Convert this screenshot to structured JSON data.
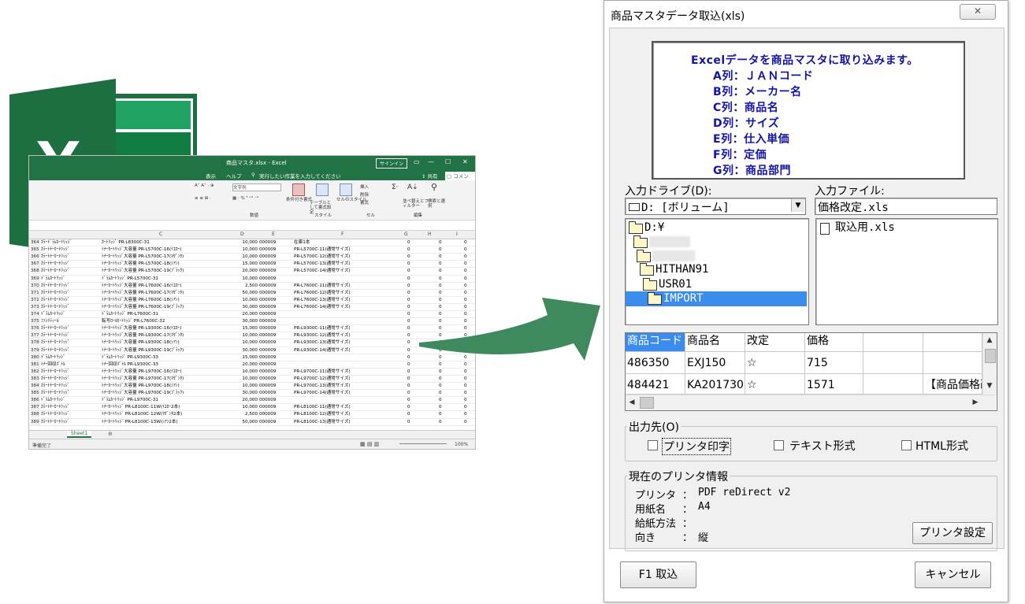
{
  "excel": {
    "title": "商品マスタ.xlsx - Excel",
    "signin_label": "サインイン",
    "tabs": [
      "表示",
      "ヘルプ",
      "実行したい作業を入力してください"
    ],
    "share_label": "共有",
    "comment_label": "コメント",
    "ribbon_groups": [
      "数値",
      "スタイル",
      "セル",
      "編集"
    ],
    "ribbon_buttons": [
      "条件付き書式",
      "テーブルとして書式設定",
      "セルのスタイル",
      "挿入",
      "削除",
      "書式",
      "並べ替えとフィルター",
      "検索と選択"
    ],
    "number_format": "文字列",
    "columns": [
      "C",
      "D",
      "E",
      "F",
      "G",
      "H",
      "I"
    ],
    "rows": [
      {
        "n": "364",
        "a": "ｶﾗｰﾄﾞﾗﾑｶｰﾄﾘｯｼﾞ",
        "c": "ｶｰﾄﾘｯｼﾞ PR-L8300C-31",
        "d": "10,000",
        "e": "000009",
        "f": "在庫1本",
        "g": "0",
        "h": "0",
        "i": "0"
      },
      {
        "n": "365",
        "a": "ｶﾗｰﾄﾅｰｶｰﾄﾘｯｼﾞ",
        "c": "ﾄﾅｰｶｰﾄﾘｯｼﾞ大容量 PR-L5700C-16(ｲｴﾛｰ)",
        "d": "10,000",
        "e": "000009",
        "f": "PR-L5700C-11(通常サイズ)",
        "g": "0",
        "h": "0",
        "i": "0"
      },
      {
        "n": "366",
        "a": "ｶﾗｰﾄﾅｰｶｰﾄﾘｯｼﾞ",
        "c": "ﾄﾅｰｶｰﾄﾘｯｼﾞ大容量 PR-L5700C-17(ﾏｾﾞﾝﾀ)",
        "d": "10,000",
        "e": "000009",
        "f": "PR-L5700C-12(通常サイズ)",
        "g": "0",
        "h": "0",
        "i": "0"
      },
      {
        "n": "367",
        "a": "ｶﾗｰﾄﾅｰｶｰﾄﾘｯｼﾞ",
        "c": "ﾄﾅｰｶｰﾄﾘｯｼﾞ大容量 PR-L5700C-18(ｼｱﾝ)",
        "d": "15,000",
        "e": "000009",
        "f": "PR-L5700C-13(通常サイズ)",
        "g": "0",
        "h": "0",
        "i": "0"
      },
      {
        "n": "368",
        "a": "ｶﾗｰﾄﾅｰｶｰﾄﾘｯｼﾞ",
        "c": "ﾄﾅｰｶｰﾄﾘｯｼﾞ大容量 PR-L5700C-19(ﾌﾞﾗｯｸ)",
        "d": "20,000",
        "e": "000009",
        "f": "PR-L5700C-14(通常サイズ)",
        "g": "0",
        "h": "0",
        "i": "0"
      },
      {
        "n": "369",
        "a": "ﾄﾞﾗﾑｶｰﾄﾘｯｼﾞ",
        "c": "ﾄﾞﾗﾑｶｰﾄﾘｯｼﾞ PR-L5700C-31",
        "d": "10,000",
        "e": "000009",
        "f": "",
        "g": "0",
        "h": "0",
        "i": "0"
      },
      {
        "n": "370",
        "a": "ｶﾗｰﾄﾅｰｶｰﾄﾘｯｼﾞ",
        "c": "ﾄﾅｰｶｰﾄﾘｯｼﾞ大容量 PR-L7600C-16(ｲｴﾛｰ)",
        "d": "2,500",
        "e": "000009",
        "f": "PR-L7600C-11(通常サイズ)",
        "g": "0",
        "h": "0",
        "i": "0"
      },
      {
        "n": "371",
        "a": "ｶﾗｰﾄﾅｰｶｰﾄﾘｯｼﾞ",
        "c": "ﾄﾅｰｶｰﾄﾘｯｼﾞ大容量 PR-L7600C-17(ﾏｾﾞﾝﾀ)",
        "d": "50,000",
        "e": "000009",
        "f": "PR-L7600C-12(通常サイズ)",
        "g": "0",
        "h": "0",
        "i": "0"
      },
      {
        "n": "372",
        "a": "ｶﾗｰﾄﾅｰｶｰﾄﾘｯｼﾞ",
        "c": "ﾄﾅｰｶｰﾄﾘｯｼﾞ大容量 PR-L7600C-18(ｼｱﾝ)",
        "d": "10,000",
        "e": "000009",
        "f": "PR-L7600C-13(通常サイズ)",
        "g": "0",
        "h": "0",
        "i": "0"
      },
      {
        "n": "373",
        "a": "ｶﾗｰﾄﾅｰｶｰﾄﾘｯｼﾞ",
        "c": "ﾄﾅｰｶｰﾄﾘｯｼﾞ大容量 PR-L7600C-19(ﾌﾞﾗｯｸ)",
        "d": "30,000",
        "e": "000009",
        "f": "PR-L7600C-14(通常サイズ)",
        "g": "0",
        "h": "0",
        "i": "0"
      },
      {
        "n": "374",
        "a": "ﾄﾞﾗﾑｶｰﾄﾘｯｼﾞ",
        "c": "ﾄﾞﾗﾑｶｰﾄﾘｯｼﾞ PR-L7600C-31",
        "d": "20,000",
        "e": "000009",
        "f": "",
        "g": "0",
        "h": "0",
        "i": "0"
      },
      {
        "n": "375",
        "a": "ﾌｧｼﾘﾃｨｰﾙ",
        "c": "転写ﾛｰﾙｶｰﾄﾘｯｼﾞ PR-L7600C-32",
        "d": "30,000",
        "e": "000009",
        "f": "",
        "g": "0",
        "h": "0",
        "i": "0"
      },
      {
        "n": "376",
        "a": "ｶﾗｰﾄﾅｰｶｰﾄﾘｯｼﾞ",
        "c": "ﾄﾅｰｶｰﾄﾘｯｼﾞ大容量 PR-L9300C-16(ｲｴﾛｰ)",
        "d": "15,000",
        "e": "000009",
        "f": "PR-L9300C-11(通常サイズ)",
        "g": "0",
        "h": "0",
        "i": "0"
      },
      {
        "n": "377",
        "a": "ｶﾗｰﾄﾅｰｶｰﾄﾘｯｼﾞ",
        "c": "ﾄﾅｰｶｰﾄﾘｯｼﾞ大容量 PR-L9300C-17(ﾏｾﾞﾝﾀ)",
        "d": "10,000",
        "e": "000009",
        "f": "PR-L9300C-12(通常サイズ)",
        "g": "0",
        "h": "0",
        "i": "0"
      },
      {
        "n": "378",
        "a": "ｶﾗｰﾄﾅｰｶｰﾄﾘｯｼﾞ",
        "c": "ﾄﾅｰｶｰﾄﾘｯｼﾞ大容量 PR-L9300C-18(ｼｱﾝ)",
        "d": "10,000",
        "e": "000009",
        "f": "PR-L9300C-13(通常サイズ)",
        "g": "0",
        "h": "0",
        "i": "0"
      },
      {
        "n": "379",
        "a": "ｶﾗｰﾄﾅｰｶｰﾄﾘｯｼﾞ",
        "c": "ﾄﾅｰｶｰﾄﾘｯｼﾞ大容量 PR-L9300C-19(ﾌﾞﾗｯｸ)",
        "d": "30,000",
        "e": "000009",
        "f": "PR-L9300C-14(通常サイズ)",
        "g": "0",
        "h": "0",
        "i": "0"
      },
      {
        "n": "380",
        "a": "ﾄﾞﾗﾑｶｰﾄﾘｯｼﾞ",
        "c": "ﾄﾞﾗﾑｶｰﾄﾘｯｼﾞ PR-L9300C-33",
        "d": "15,000",
        "e": "000009",
        "f": "",
        "g": "0",
        "h": "0",
        "i": "0"
      },
      {
        "n": "381",
        "a": "ﾄﾅｰ回収ﾎﾞﾄﾙ",
        "c": "ﾄﾅｰ回収ﾎﾞﾄﾙ PR-L9300C-33",
        "d": "20,000",
        "e": "000009",
        "f": "",
        "g": "0",
        "h": "0",
        "i": "0"
      },
      {
        "n": "382",
        "a": "ｶﾗｰﾄﾅｰｶｰﾄﾘｯｼﾞ",
        "c": "ﾄﾅｰｶｰﾄﾘｯｼﾞ大容量 PR-L9700C-16(ｲｴﾛｰ)",
        "d": "10,000",
        "e": "000009",
        "f": "PR-L9700C-11(通常サイズ)",
        "g": "0",
        "h": "0",
        "i": "0"
      },
      {
        "n": "383",
        "a": "ｶﾗｰﾄﾅｰｶｰﾄﾘｯｼﾞ",
        "c": "ﾄﾅｰｶｰﾄﾘｯｼﾞ大容量 PR-L9700C-17(ﾏｾﾞﾝﾀ)",
        "d": "10,000",
        "e": "000009",
        "f": "PR-L9700C-12(通常サイズ)",
        "g": "0",
        "h": "0",
        "i": "0"
      },
      {
        "n": "384",
        "a": "ｶﾗｰﾄﾅｰｶｰﾄﾘｯｼﾞ",
        "c": "ﾄﾅｰｶｰﾄﾘｯｼﾞ大容量 PR-L9700C-18(ｼｱﾝ)",
        "d": "10,000",
        "e": "000009",
        "f": "PR-L9700C-13(通常サイズ)",
        "g": "0",
        "h": "0",
        "i": "0"
      },
      {
        "n": "385",
        "a": "ｶﾗｰﾄﾅｰｶｰﾄﾘｯｼﾞ",
        "c": "ﾄﾅｰｶｰﾄﾘｯｼﾞ大容量 PR-L9700C-19(ﾌﾞﾗｯｸ)",
        "d": "30,000",
        "e": "000009",
        "f": "PR-L9700C-14(通常サイズ)",
        "g": "0",
        "h": "0",
        "i": "0"
      },
      {
        "n": "386",
        "a": "ﾄﾞﾗﾑｶｰﾄﾘｯｼﾞ",
        "c": "ﾄﾞﾗﾑｶｰﾄﾘｯｼﾞ PR-L9700C-31",
        "d": "20,000",
        "e": "000009",
        "f": "",
        "g": "0",
        "h": "0",
        "i": "0"
      },
      {
        "n": "387",
        "a": "ｶﾗｰﾄﾅｰｶｰﾄﾘｯｼﾞ",
        "c": "ﾄﾅｰｶｰﾄﾘｯｼﾞ PR-L8100C-11W(ｲｴﾛｰ2本)",
        "d": "10,000",
        "e": "000009",
        "f": "PR-L8100C-11(通常サイズ)",
        "g": "0",
        "h": "0",
        "i": "0"
      },
      {
        "n": "388",
        "a": "ｶﾗｰﾄﾅｰｶｰﾄﾘｯｼﾞ",
        "c": "ﾄﾅｰｶｰﾄﾘｯｼﾞ PR-L8100C-12W(ﾏｾﾞﾝﾀ2本)",
        "d": "2,500",
        "e": "000009",
        "f": "PR-L8100C-12(通常サイズ)",
        "g": "0",
        "h": "0",
        "i": "0"
      },
      {
        "n": "389",
        "a": "ｶﾗｰﾄﾅｰｶｰﾄﾘｯｼﾞ",
        "c": "ﾄﾅｰｶｰﾄﾘｯｼﾞ PR-L8100C-13W(ｼｱﾝ2本)",
        "d": "50,000",
        "e": "000009",
        "f": "PR-L8100C-13(通常サイズ)",
        "g": "0",
        "h": "0",
        "i": "0"
      }
    ],
    "sheet_tab": "Sheet1",
    "status_text": "準備完了",
    "zoom": "100%"
  },
  "dialog": {
    "title": "商品マスタデータ取込(xls)",
    "info_lines": [
      "Excelデータを商品マスタに取り込みます。",
      "A列：ＪＡＮコード",
      "B列：メーカー名",
      "C列：商品名",
      "D列：サイズ",
      "E列：仕入単価",
      "F列：定価",
      "G列：商品部門"
    ],
    "drive_label": "入力ドライブ(D):",
    "file_label": "入力ファイル:",
    "drive_value": "D: [ボリューム]",
    "file_value": "価格改定.xls",
    "dirs": [
      "D:¥",
      "HITHAN91",
      "USR01",
      "IMPORT"
    ],
    "files": [
      "取込用.xls"
    ],
    "grid": {
      "headers": [
        "商品コード",
        "商品名",
        "改定",
        "価格"
      ],
      "rows": [
        {
          "code": "486350",
          "name": "EXJ150",
          "kaitei": "☆",
          "price": "715",
          "note": ""
        },
        {
          "code": "484421",
          "name": "KA201730",
          "kaitei": "☆",
          "price": "1571",
          "note": "【商品価格改"
        }
      ]
    },
    "output": {
      "group_label": "出力先(O)",
      "options": [
        {
          "label": "プリンタ印字",
          "checked": false
        },
        {
          "label": "テキスト形式",
          "checked": false
        },
        {
          "label": "HTML形式",
          "checked": false
        }
      ]
    },
    "printer": {
      "group_label": "現在のプリンタ情報",
      "rows": [
        {
          "key": "プリンタ",
          "value": "PDF reDirect v2"
        },
        {
          "key": "用紙名",
          "value": "A4"
        },
        {
          "key": "給紙方法",
          "value": ""
        },
        {
          "key": "向き",
          "value": "縦"
        }
      ],
      "settings_button": "プリンタ設定"
    },
    "buttons": {
      "import": "F1 取込",
      "cancel": "キャンセル"
    }
  },
  "colors": {
    "excel_green": "#217346",
    "arrow_green": "#3e8a5e",
    "info_text": "#1414a8",
    "selection": "#3c8cee"
  }
}
